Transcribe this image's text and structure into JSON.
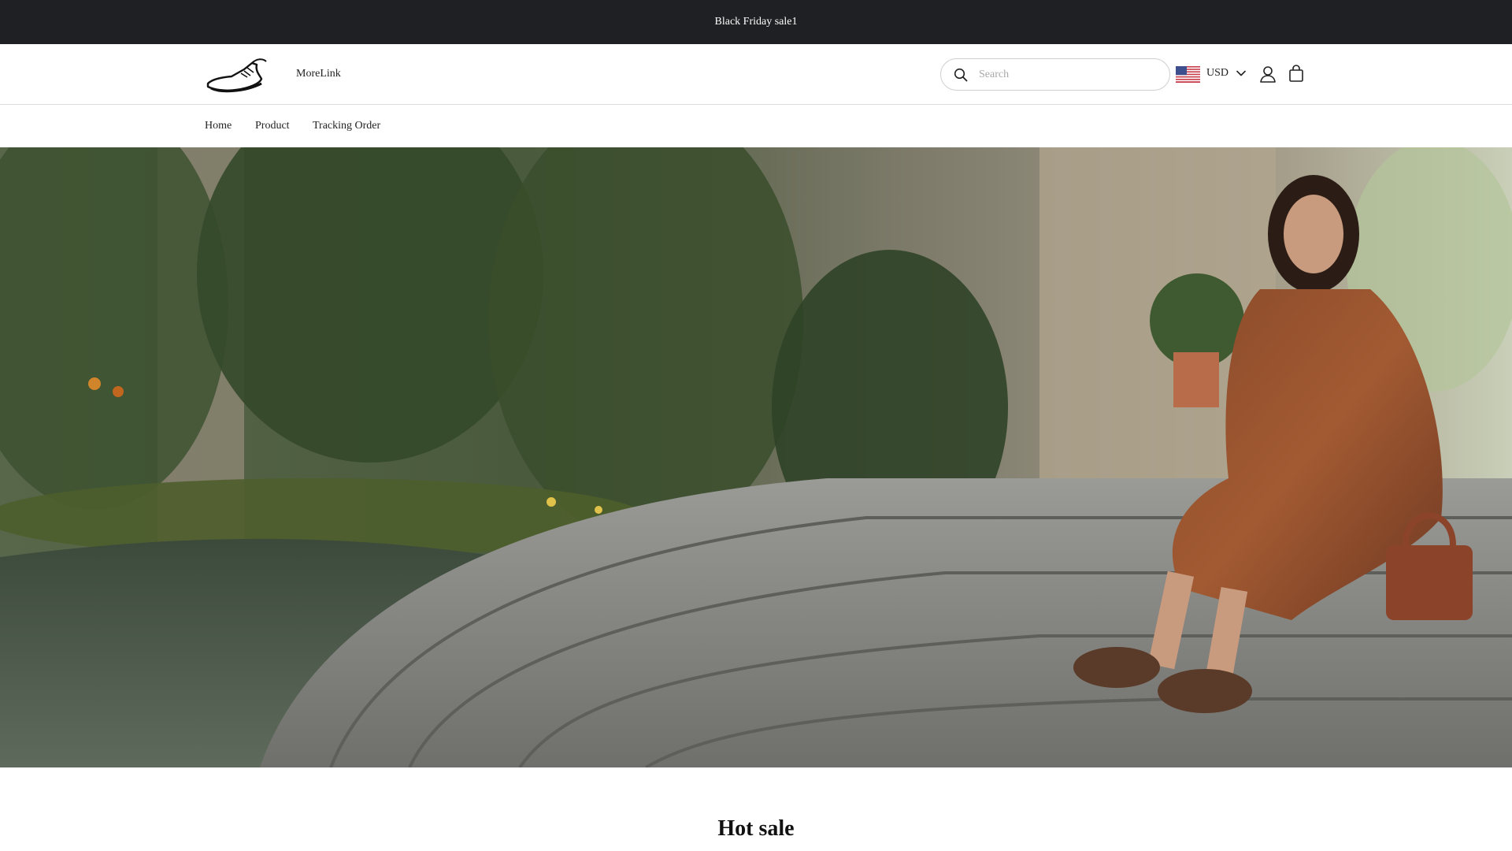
{
  "announcement": {
    "text": "Black Friday sale1"
  },
  "header": {
    "brand": "MoreLink",
    "search": {
      "placeholder": "Search",
      "value": ""
    },
    "currency": {
      "selected": "USD",
      "flag": "us-flag-icon"
    },
    "icons": [
      "search-icon",
      "us-flag-icon",
      "chevron-down-icon",
      "account-icon",
      "shopping-bag-icon"
    ]
  },
  "nav": {
    "items": [
      {
        "label": "Home"
      },
      {
        "label": "Product"
      },
      {
        "label": "Tracking Order"
      }
    ]
  },
  "hero": {
    "image": "hero-banner-photo"
  },
  "sections": {
    "hot_sale_title": "Hot sale"
  },
  "colors": {
    "announcement_bg": "#1f2024",
    "announcement_text": "#ffffff",
    "border": "#dcdcdc"
  }
}
